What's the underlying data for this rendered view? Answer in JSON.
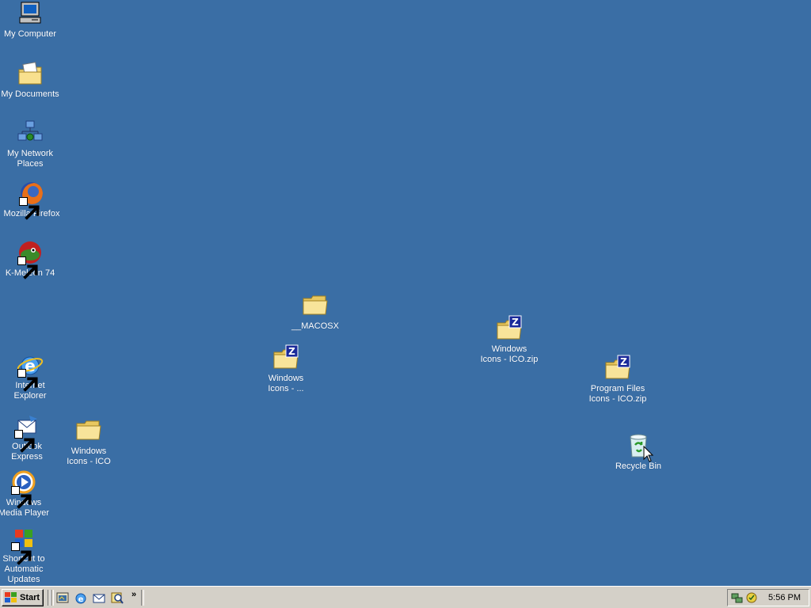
{
  "desktop": {
    "background": "#3a6ea5",
    "icons": {
      "my_computer": "My Computer",
      "my_documents": "My Documents",
      "my_network_places": "My Network\nPlaces",
      "mozilla_firefox": "Mozilla Firefox",
      "k_meleon": "K-Meleon 74",
      "internet_explorer": "Internet\nExplorer",
      "outlook_express": "Outlook\nExpress",
      "windows_media_player": "Windows\nMedia Player",
      "automatic_updates": "Shortcut to\nAutomatic\nUpdates",
      "windows_icons_ico_folder": "Windows\nIcons - ICO",
      "macosx_folder": "__MACOSX",
      "windows_icons_truncated": "Windows\nIcons - ...",
      "windows_icons_zip": "Windows\nIcons - ICO.zip",
      "program_files_icons_zip": "Program Files\nIcons - ICO.zip",
      "recycle_bin": "Recycle Bin"
    }
  },
  "taskbar": {
    "start_label": "Start",
    "quick_launch_more": "»",
    "clock": "5:56 PM"
  }
}
